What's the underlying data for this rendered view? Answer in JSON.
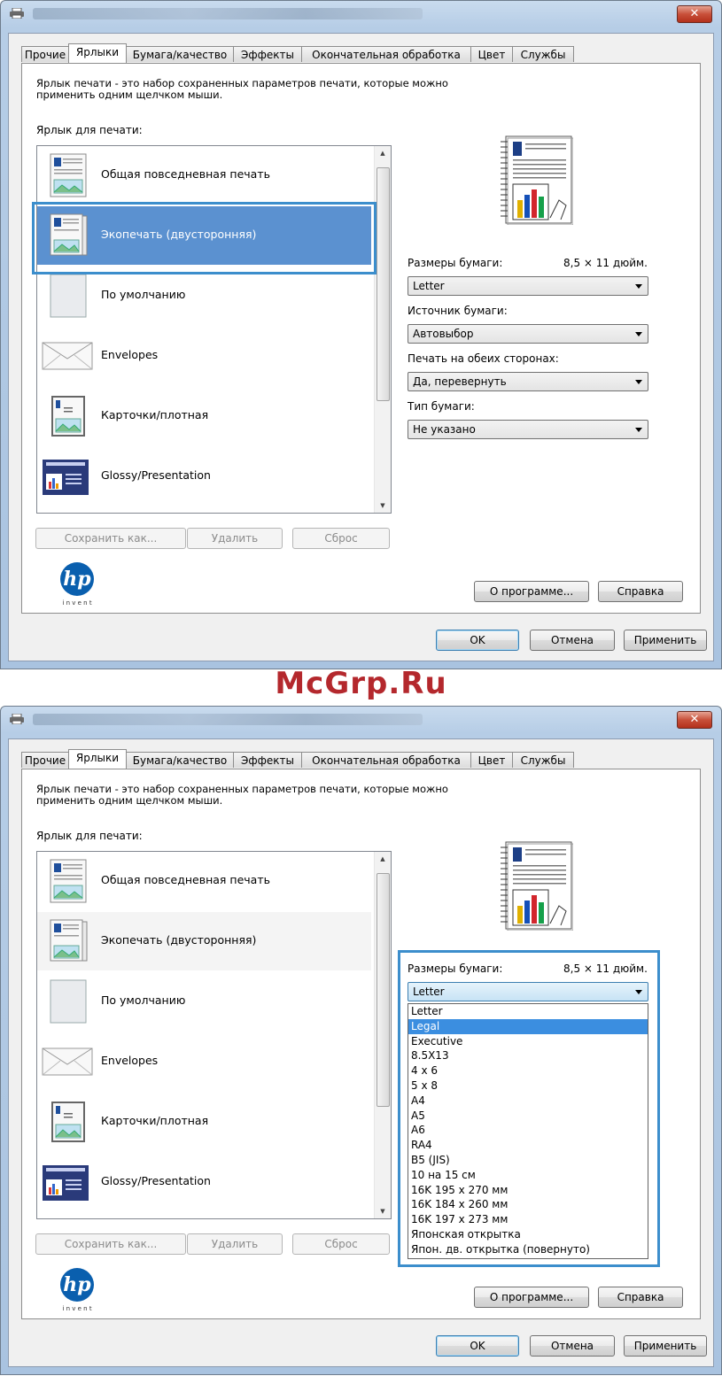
{
  "watermark": "McGrp.Ru",
  "dialog": {
    "close_label": "✕",
    "tabs": [
      "Прочие",
      "Ярлыки",
      "Бумага/качество",
      "Эффекты",
      "Окончательная обработка",
      "Цвет",
      "Службы"
    ],
    "description": "Ярлык печати - это набор сохраненных параметров печати, которые можно применить одним щелчком мыши.",
    "shortcut_label": "Ярлык для печати:",
    "shortcuts": [
      "Общая повседневная печать",
      "Экопечать (двусторонняя)",
      "По умолчанию",
      "Envelopes",
      "Карточки/плотная",
      "Glossy/Presentation"
    ],
    "buttons": {
      "save_as": "Сохранить как...",
      "delete": "Удалить",
      "reset": "Сброс",
      "about": "О программе...",
      "help": "Справка",
      "ok": "OK",
      "cancel": "Отмена",
      "apply": "Применить"
    },
    "hp_logo_text": "hp",
    "hp_invent": "i n v e n t",
    "paper_size_label": "Размеры бумаги:",
    "paper_size_dims": "8,5 × 11 дюйм.",
    "paper_size_value": "Letter",
    "paper_source_label": "Источник бумаги:",
    "paper_source_value": "Автовыбор",
    "duplex_label": "Печать на обеих сторонах:",
    "duplex_value": "Да, перевернуть",
    "paper_type_label": "Тип бумаги:",
    "paper_type_value": "Не указано",
    "paper_size_options": [
      "Letter",
      "Legal",
      "Executive",
      "8.5X13",
      "4 x 6",
      "5 x 8",
      "A4",
      "A5",
      "A6",
      "RA4",
      "B5 (JIS)",
      "10 на 15 см",
      "16K 195 x 270 мм",
      "16K 184 x 260 мм",
      "16K 197 x 273 мм",
      "Японская открытка",
      "Япон. дв. открытка (повернуто)"
    ],
    "highlighted_option": "Legal",
    "colors": {
      "selection": "#5b91d0",
      "callout_border": "#3c8ecc",
      "watermark": "#b4282d"
    }
  }
}
